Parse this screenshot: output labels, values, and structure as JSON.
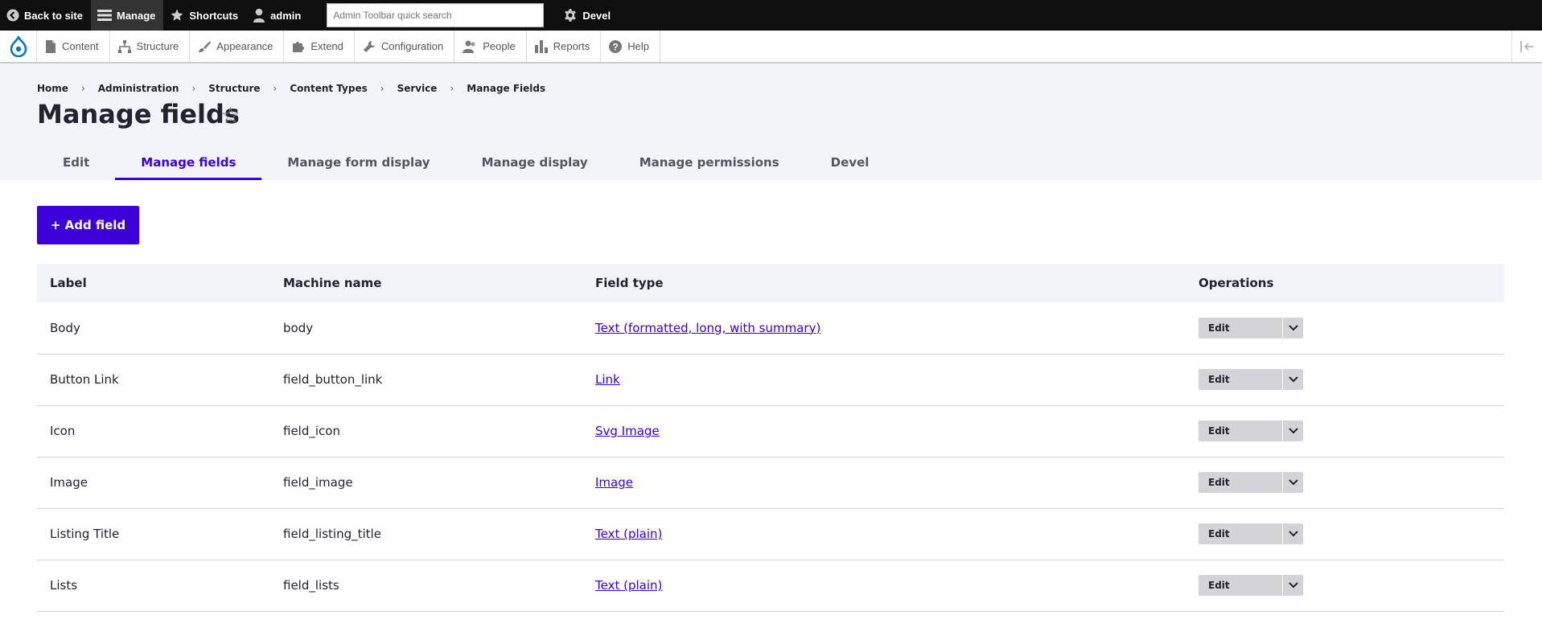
{
  "toolbar": {
    "back_to_site": "Back to site",
    "manage": "Manage",
    "shortcuts": "Shortcuts",
    "user": "admin",
    "search_placeholder": "Admin Toolbar quick search",
    "devel": "Devel"
  },
  "tray": {
    "items": [
      {
        "label": "Content",
        "icon": "file-icon"
      },
      {
        "label": "Structure",
        "icon": "structure-icon"
      },
      {
        "label": "Appearance",
        "icon": "paintbrush-icon"
      },
      {
        "label": "Extend",
        "icon": "puzzle-icon"
      },
      {
        "label": "Configuration",
        "icon": "wrench-icon"
      },
      {
        "label": "People",
        "icon": "people-icon"
      },
      {
        "label": "Reports",
        "icon": "bar-chart-icon"
      },
      {
        "label": "Help",
        "icon": "help-icon"
      }
    ]
  },
  "breadcrumb": [
    "Home",
    "Administration",
    "Structure",
    "Content Types",
    "Service",
    "Manage Fields"
  ],
  "page": {
    "title": "Manage fields",
    "star": "☆"
  },
  "tabs": [
    {
      "label": "Edit",
      "active": false
    },
    {
      "label": "Manage fields",
      "active": true
    },
    {
      "label": "Manage form display",
      "active": false
    },
    {
      "label": "Manage display",
      "active": false
    },
    {
      "label": "Manage permissions",
      "active": false
    },
    {
      "label": "Devel",
      "active": false
    }
  ],
  "actions": {
    "add_field": "+ Add field"
  },
  "table": {
    "headers": [
      "Label",
      "Machine name",
      "Field type",
      "Operations"
    ],
    "rows": [
      {
        "label": "Body",
        "machine": "body",
        "type": "Text (formatted, long, with summary)",
        "op": "Edit"
      },
      {
        "label": "Button Link",
        "machine": "field_button_link",
        "type": "Link",
        "op": "Edit"
      },
      {
        "label": "Icon",
        "machine": "field_icon",
        "type": "Svg Image",
        "op": "Edit"
      },
      {
        "label": "Image",
        "machine": "field_image",
        "type": "Image",
        "op": "Edit"
      },
      {
        "label": "Listing Title",
        "machine": "field_listing_title",
        "type": "Text (plain)",
        "op": "Edit"
      },
      {
        "label": "Lists",
        "machine": "field_lists",
        "type": "Text (plain)",
        "op": "Edit"
      }
    ]
  },
  "colors": {
    "accent": "#3b00d7",
    "toolbar_bg": "#0f0f0f",
    "header_bg": "#f3f4f9"
  }
}
